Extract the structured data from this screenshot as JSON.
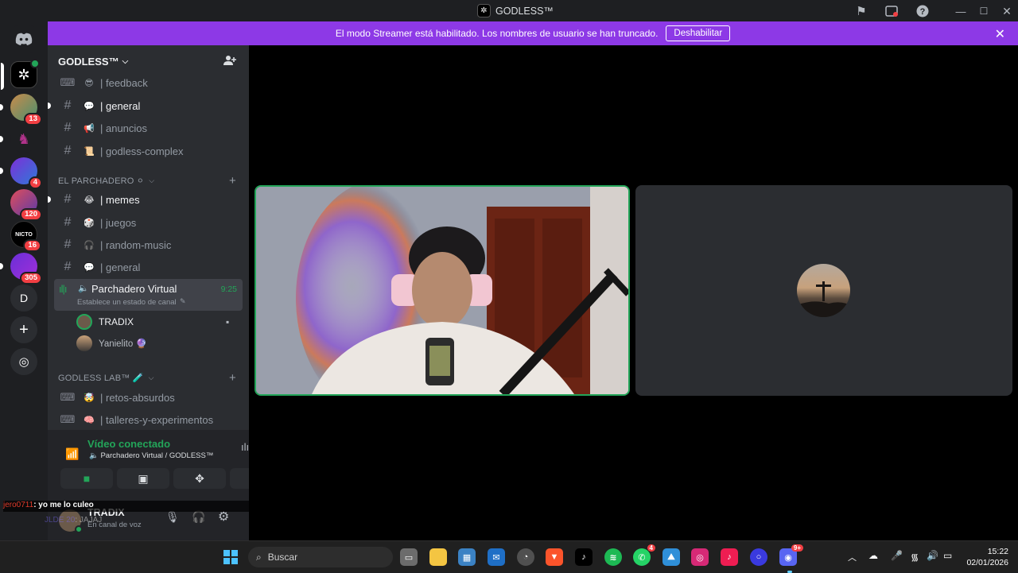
{
  "window": {
    "title": "GODLESS™"
  },
  "banner": {
    "text": "El modo Streamer está habilitado. Los nombres de usuario se han truncado.",
    "button": "Deshabilitar"
  },
  "servers": [
    {
      "badge": ""
    },
    {
      "badge": "13"
    },
    {
      "badge": ""
    },
    {
      "badge": "4"
    },
    {
      "badge": "120"
    },
    {
      "badge": "16",
      "label": "NICTO"
    },
    {
      "badge": "305"
    },
    {
      "label": "D"
    }
  ],
  "guild": {
    "name": "GODLESS™"
  },
  "channels": {
    "top": [
      {
        "name": "| feedback",
        "emoji": "😎"
      },
      {
        "name": "| general",
        "emoji": "💬"
      },
      {
        "name": "| anuncios",
        "emoji": "📢"
      },
      {
        "name": "| godless-complex",
        "emoji": "📜"
      }
    ],
    "cat1": {
      "name": "EL PARCHADERO ⚪"
    },
    "parchadero": [
      {
        "name": "| memes",
        "emoji": "😂"
      },
      {
        "name": "| juegos",
        "emoji": "🎲"
      },
      {
        "name": "| random-music",
        "emoji": "🎧"
      },
      {
        "name": "| general",
        "emoji": "💬"
      }
    ],
    "voice": {
      "name": "Parchadero Virtual",
      "time": "9:25",
      "status": "Establece un estado de canal"
    },
    "voice_users": [
      {
        "name": "TRADIX"
      },
      {
        "name": "Yanielito 🔮"
      }
    ],
    "cat2": {
      "name": "GODLESS LAB™ 🧪"
    },
    "lab": [
      {
        "name": "| retos-absurdos",
        "emoji": "🤯"
      },
      {
        "name": "| talleres-y-experimentos",
        "emoji": "🧠"
      }
    ]
  },
  "voice_panel": {
    "title": "Vídeo conectado",
    "subtitle": "Parchadero Virtual / GODLESS™"
  },
  "chat": [
    {
      "user": "jero0711",
      "text": ": yo me lo culeo"
    },
    {
      "user": "JLDE 20",
      "text": ": JAJAJ"
    }
  ],
  "user_panel": {
    "name": "TRADIX",
    "status": "En canal de voz"
  },
  "taskbar": {
    "search": "Buscar",
    "time": "15:22",
    "date": "02/01/2026",
    "badge_wa": "4",
    "badge_discord": "9+"
  },
  "colors": {
    "accent": "#8d39e6",
    "green": "#23a559",
    "red": "#f23f43"
  }
}
